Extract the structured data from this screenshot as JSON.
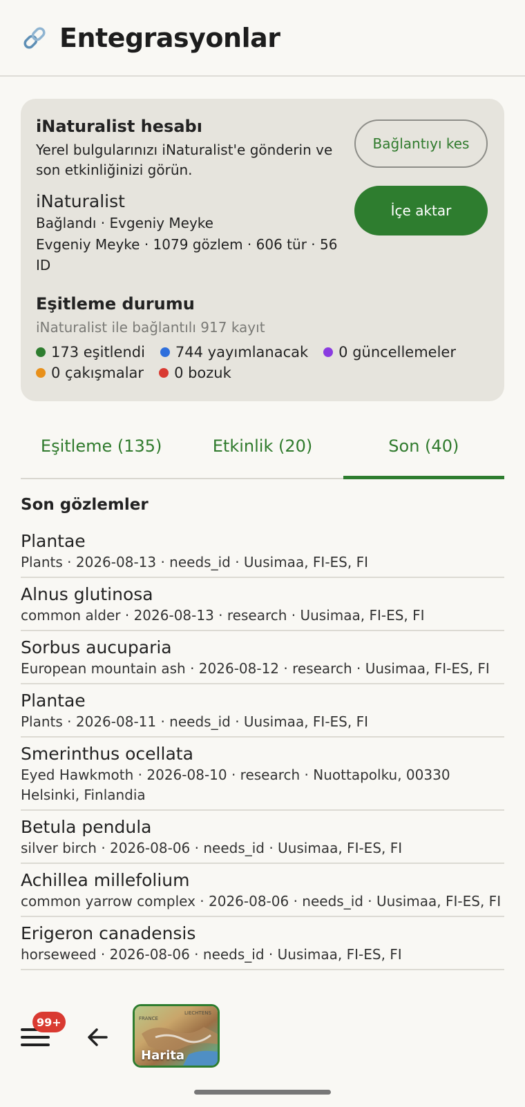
{
  "header": {
    "title": "Entegrasyonlar",
    "icon": "link-icon"
  },
  "account": {
    "title": "iNaturalist hesabı",
    "description": "Yerel bulgularınızı iNaturalist'e gönderin ve son etkinliğinizi görün.",
    "service": "iNaturalist",
    "status": "Bağlandı · Evgeniy Meyke",
    "stats": "Evgeniy Meyke · 1079 gözlem · 606 tür · 56 ID",
    "disconnect_label": "Bağlantıyı kes",
    "import_label": "İçe aktar"
  },
  "sync": {
    "title": "Eşitleme durumu",
    "subtitle": "iNaturalist ile bağlantılı 917 kayıt",
    "legend": [
      {
        "label": "173 eşitlendi",
        "color": "#2e7d2f"
      },
      {
        "label": "744 yayımlanacak",
        "color": "#2f6fdc"
      },
      {
        "label": "0 güncellemeler",
        "color": "#8a3be0"
      },
      {
        "label": "0 çakışmalar",
        "color": "#e8901a"
      },
      {
        "label": "0 bozuk",
        "color": "#d93a31"
      }
    ]
  },
  "tabs": [
    {
      "label": "Eşitleme (135)",
      "active": false
    },
    {
      "label": "Etkinlik (20)",
      "active": false
    },
    {
      "label": "Son (40)",
      "active": true
    }
  ],
  "recent": {
    "title": "Son gözlemler",
    "items": [
      {
        "name": "Plantae",
        "meta": "Plants · 2026-08-13 · needs_id · Uusimaa, FI-ES, FI"
      },
      {
        "name": "Alnus glutinosa",
        "meta": "common alder · 2026-08-13 · research · Uusimaa, FI-ES, FI"
      },
      {
        "name": "Sorbus aucuparia",
        "meta": "European mountain ash · 2026-08-12 · research · Uusimaa, FI-ES, FI"
      },
      {
        "name": "Plantae",
        "meta": "Plants · 2026-08-11 · needs_id · Uusimaa, FI-ES, FI"
      },
      {
        "name": "Smerinthus ocellata",
        "meta": "Eyed Hawkmoth · 2026-08-10 · research · Nuottapolku, 00330 Helsinki, Finlandia"
      },
      {
        "name": "Betula pendula",
        "meta": "silver birch · 2026-08-06 · needs_id · Uusimaa, FI-ES, FI"
      },
      {
        "name": "Achillea millefolium",
        "meta": "common yarrow complex · 2026-08-06 · needs_id · Uusimaa, FI-ES, FI"
      },
      {
        "name": "Erigeron canadensis",
        "meta": "horseweed · 2026-08-06 · needs_id · Uusimaa, FI-ES, FI"
      }
    ]
  },
  "bottom": {
    "badge": "99+",
    "map_label": "Harita",
    "map_tiny_1": "FRANCE",
    "map_tiny_2": "LIECHTENS"
  }
}
